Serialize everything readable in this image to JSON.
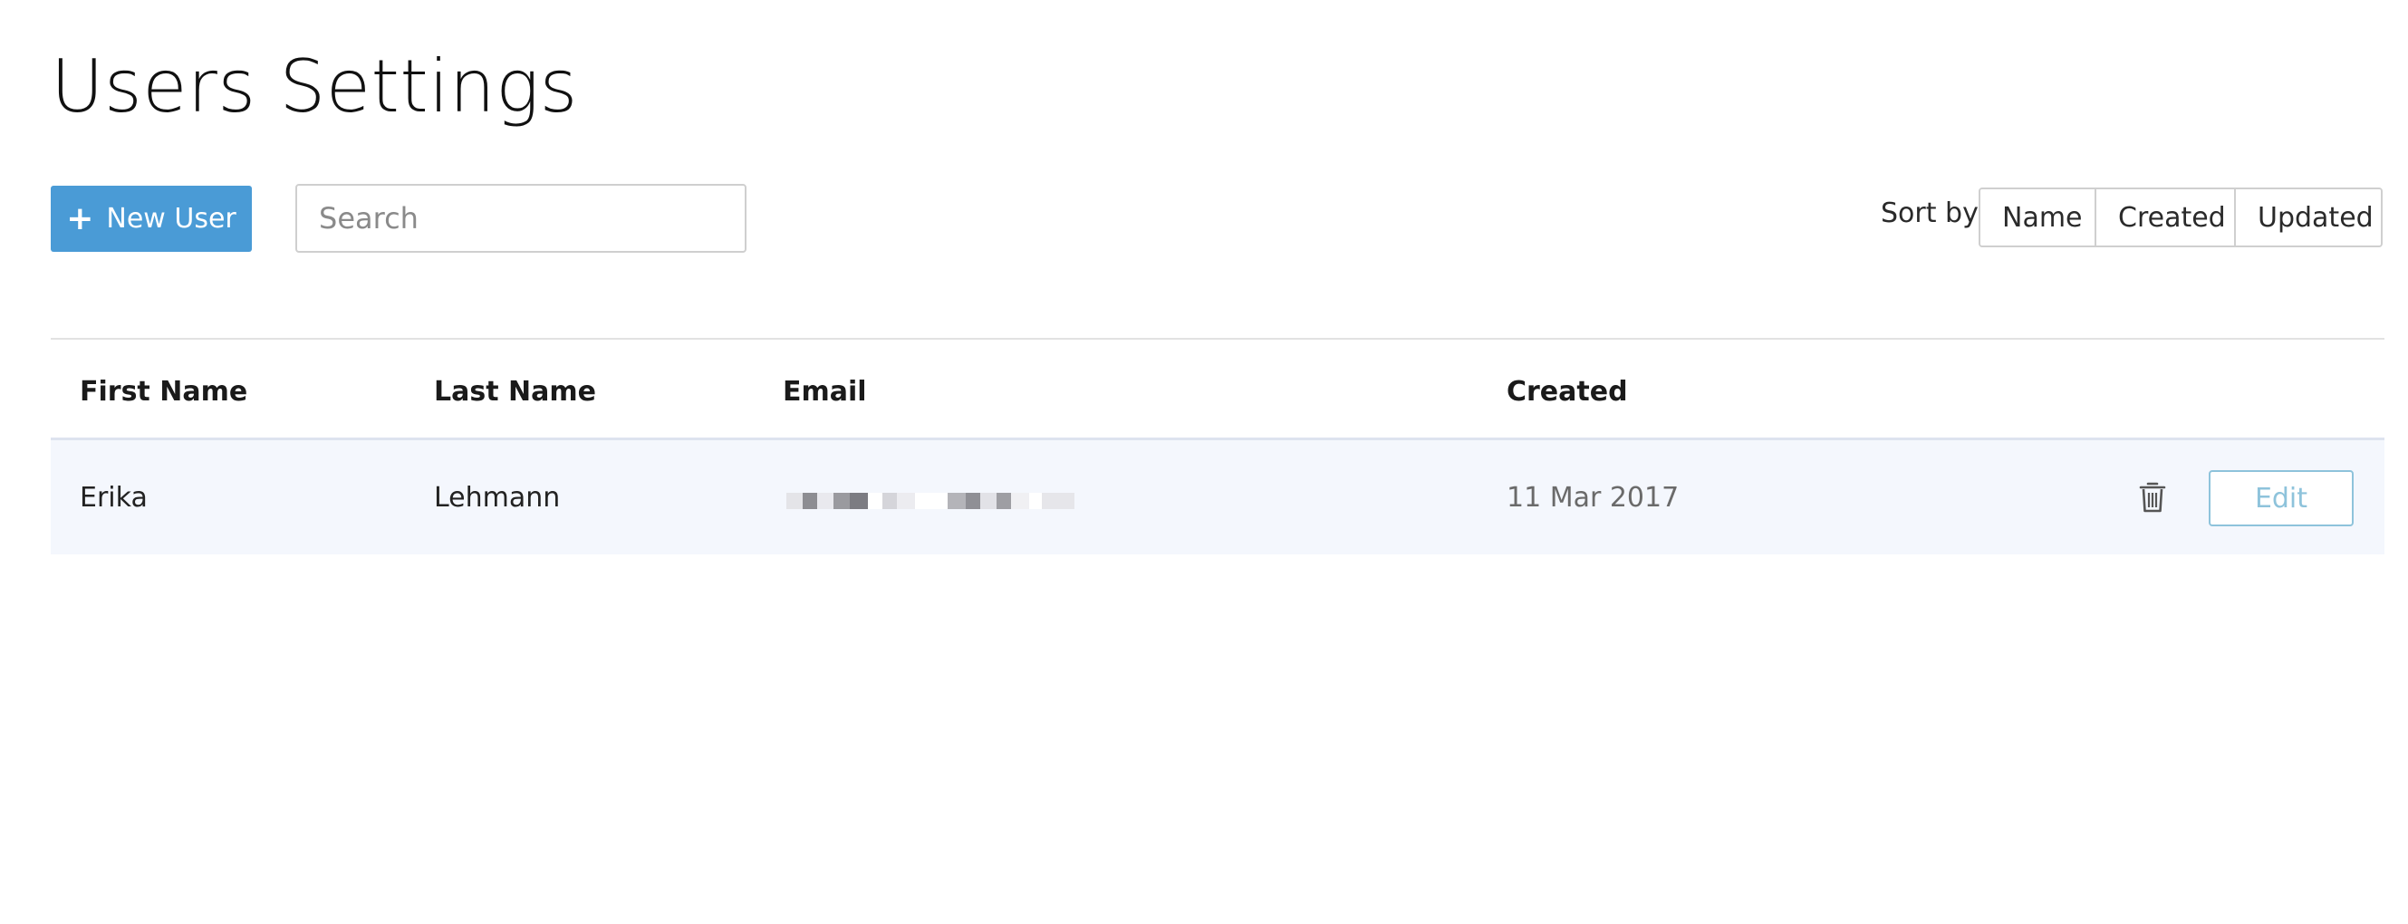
{
  "page": {
    "title": "Users Settings"
  },
  "toolbar": {
    "new_user_label": "New User",
    "search_placeholder": "Search",
    "sort_label": "Sort by",
    "sort_options": [
      "Name",
      "Created",
      "Updated"
    ]
  },
  "table": {
    "columns": [
      "First Name",
      "Last Name",
      "Email",
      "Created"
    ],
    "rows": [
      {
        "first_name": "Erika",
        "last_name": "Lehmann",
        "created": "11 Mar 2017",
        "edit_label": "Edit"
      }
    ]
  },
  "colors": {
    "primary": "#4a9bd6",
    "row_highlight": "#f4f7fd",
    "edit_outline": "#8ec3db"
  },
  "icons": {
    "new_user": "plus-icon",
    "delete": "trash-icon"
  }
}
